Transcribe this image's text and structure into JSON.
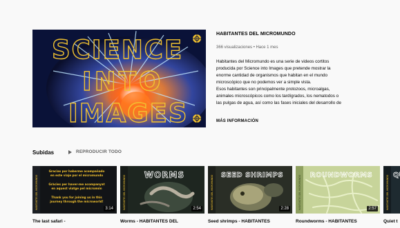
{
  "featured": {
    "thumbnail_text": [
      "SCIENCE",
      "INTO",
      "IMAGES"
    ],
    "title": "HABITANTES DEL MICROMUNDO",
    "meta": "366 visualizaciones • Hace 1 mes",
    "description": [
      "Habitantes del Micromundo es una serie de videos cortitos",
      "producida por Science into Images que pretende mostrar la",
      "enorme cantidad de organismos que habitan en el mundo",
      "microscópico que no podemos ver a simple vista.",
      "Esos habitantes son principalmente protozoos, microalgas,",
      "animales microscópicos como los tardígrados, los nematodos o",
      "las pulgas de agua, así como las fases iniciales del desarrollo de"
    ],
    "more_info": "MÁS INFORMACIÓN"
  },
  "shelf": {
    "title": "Subidas",
    "play_all": "REPRODUCIR TODO",
    "items": [
      {
        "title": "The last safari -",
        "duration": "3:14",
        "overlay_lines": [
          "Gracias por haberme acompañado",
          "en este viaje por el micromundo",
          "Gràcies per haver-me acompanyat",
          "en aquest viatge pel micromón",
          "Thank you for joining us in this",
          "journey through the microworld!"
        ],
        "side_label": "HABITANTES DEL MICROMUNDO"
      },
      {
        "title": "Worms - HABITANTES DEL",
        "duration": "2:54",
        "banner": "WORMS",
        "side_label": "HABITANTES DEL MICROMUNDO"
      },
      {
        "title": "Seed shrimps - HABITANTES",
        "duration": "2:28",
        "banner": "SEED SHRIMPS",
        "side_label": "HABITANTES DEL MICROMUNDO"
      },
      {
        "title": "Roundworms - HABITANTES",
        "duration": "2:57",
        "banner": "ROUNDWORMS",
        "side_label": "HABITANTES DEL MICROMUNDO"
      },
      {
        "title": "Quiet t",
        "duration": "",
        "banner": "QU",
        "side_label": "HABITANTES DEL MICROMUNDO"
      }
    ]
  },
  "colors": {
    "background": "#f9f9f9",
    "title_text": "#030303",
    "meta_text": "#606060",
    "brand_yellow": "#f2c230"
  }
}
